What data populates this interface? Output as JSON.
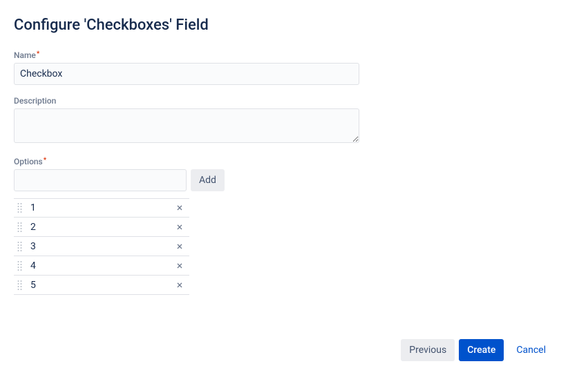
{
  "title": "Configure 'Checkboxes' Field",
  "name_field": {
    "label": "Name",
    "value": "Checkbox"
  },
  "description_field": {
    "label": "Description",
    "value": ""
  },
  "options_field": {
    "label": "Options",
    "add_button": "Add",
    "items": [
      {
        "label": "1"
      },
      {
        "label": "2"
      },
      {
        "label": "3"
      },
      {
        "label": "4"
      },
      {
        "label": "5"
      }
    ]
  },
  "footer": {
    "previous": "Previous",
    "create": "Create",
    "cancel": "Cancel"
  }
}
